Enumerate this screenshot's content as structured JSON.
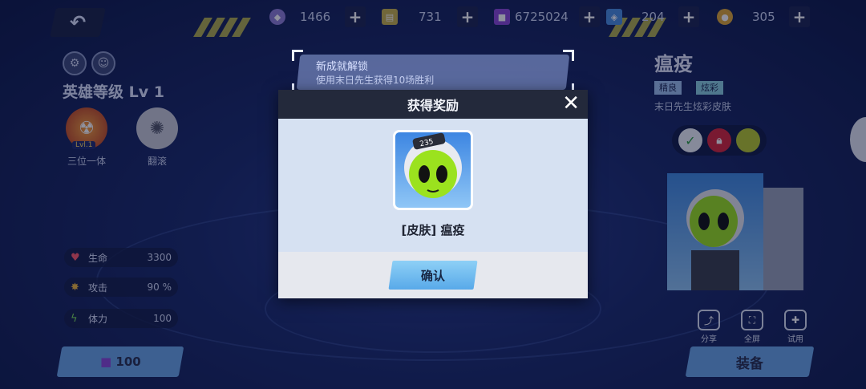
{
  "topbar": {
    "currencies": [
      {
        "icon": "gem-coin-icon",
        "value": "1466",
        "color": "#8f7fd6"
      },
      {
        "icon": "ticket-icon",
        "value": "731",
        "color": "#c9b24a"
      },
      {
        "icon": "purple-cube-icon",
        "value": "6725024",
        "color": "#8a48d8"
      },
      {
        "icon": "blue-crystal-icon",
        "value": "204",
        "color": "#4a8ee0"
      },
      {
        "icon": "gold-coin-icon",
        "value": "305",
        "color": "#e0a834"
      }
    ],
    "plus_label": "+"
  },
  "hero": {
    "level": "英雄等级 Lv 1",
    "skills": [
      {
        "label": "三位一体",
        "badge": "Lvl.1"
      },
      {
        "label": "翻滚"
      }
    ],
    "stats": [
      {
        "name": "生命",
        "value": "3300",
        "icon": "heart-icon"
      },
      {
        "name": "攻击",
        "value": "90 %",
        "icon": "attack-icon"
      },
      {
        "name": "体力",
        "value": "100",
        "icon": "stamina-icon"
      }
    ],
    "buy_price": "100"
  },
  "skin": {
    "title": "瘟疫",
    "tags": [
      "精良",
      "炫彩"
    ],
    "description": "末日先生炫彩皮肤",
    "actions": [
      "分享",
      "全屏",
      "试用"
    ],
    "equip_label": "装备"
  },
  "toast": {
    "line1": "新成就解锁",
    "line2": "使用末日先生获得10场胜利"
  },
  "modal": {
    "title": "获得奖励",
    "close_symbol": "✕",
    "reward_name": "[皮肤] 瘟疫",
    "reward_number": "235",
    "confirm_label": "确认"
  },
  "colors": {
    "modal_header": "#23293b",
    "modal_body": "#d6e1f2",
    "button_blue": "#6aa6e8",
    "alien_green": "#9be21e"
  }
}
